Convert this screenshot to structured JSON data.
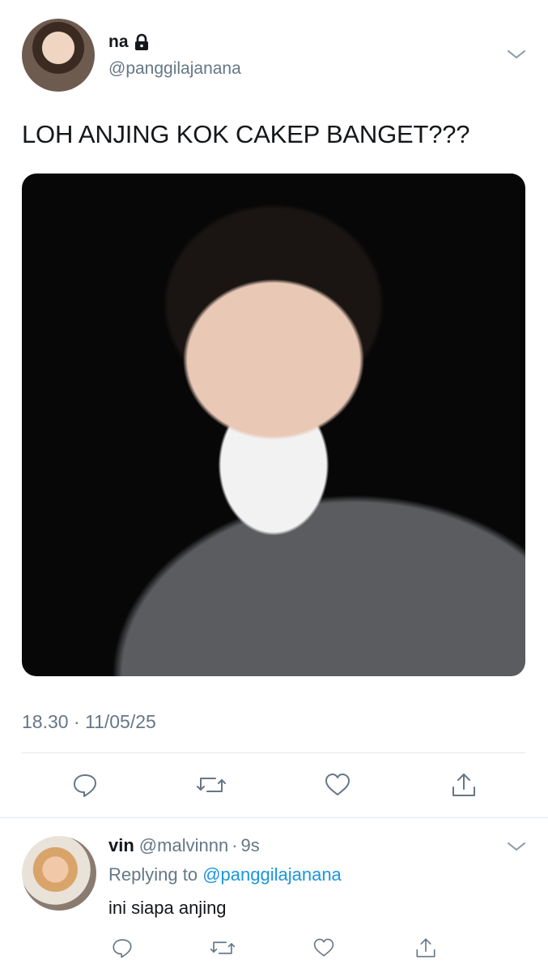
{
  "tweet": {
    "author_name": "na",
    "author_handle": "@panggilajanana",
    "text": "LOH ANJING KOK CAKEP BANGET???",
    "timestamp": "18.30 · 11/05/25",
    "lock_icon": "lock-icon",
    "menu_icon": "chevron-down-icon"
  },
  "reply": {
    "author_name": "vin",
    "author_handle": "@malvinnn",
    "age_separator": "·",
    "age": "9s",
    "replying_prefix": "Replying to",
    "replying_handle": "@panggilajanana",
    "text": "ini siapa anjing"
  },
  "colors": {
    "text": "#14171a",
    "muted": "#657786",
    "link": "#1b95e0",
    "divider": "#e1e8ed"
  },
  "actions": [
    "reply-icon",
    "retweet-icon",
    "like-icon",
    "share-icon"
  ]
}
